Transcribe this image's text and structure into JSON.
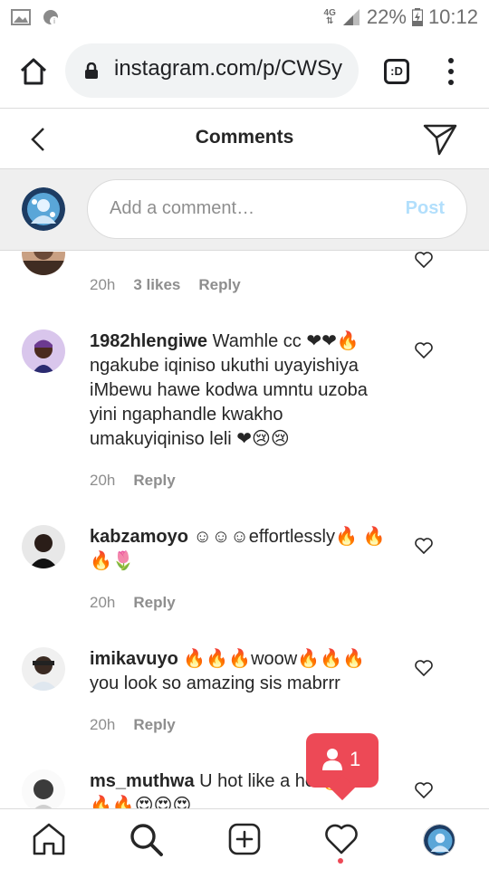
{
  "status_bar": {
    "network": "4G",
    "battery": "22%",
    "time": "10:12"
  },
  "browser": {
    "url": "instagram.com/p/CWSy",
    "tab_label": ":D"
  },
  "header": {
    "title": "Comments"
  },
  "composer": {
    "placeholder": "Add a comment…",
    "post_label": "Post"
  },
  "comments": [
    {
      "username": "",
      "text": "",
      "time": "20h",
      "likes": "3 likes",
      "reply": "Reply"
    },
    {
      "username": "1982hlengiwe",
      "text": " Wamhle cc ❤❤🔥 ngakube iqiniso ukuthi uyayishiya iMbewu hawe kodwa umntu uzoba yini ngaphandle kwakho umakuyiqiniso leli ❤😢😢",
      "time": "20h",
      "reply": "Reply"
    },
    {
      "username": "kabzamoyo",
      "text": " ☺☺☺effortlessly🔥 🔥🔥🌷",
      "time": "20h",
      "reply": "Reply"
    },
    {
      "username": "imikavuyo",
      "text": " 🔥🔥🔥woow🔥🔥🔥 you look so amazing sis mabrrr",
      "time": "20h",
      "reply": "Reply"
    },
    {
      "username": "ms_muthwa",
      "text": " U hot like a he 🔥🔥🔥😍😍😍",
      "time": "",
      "reply": ""
    }
  ],
  "notification": {
    "count": "1"
  },
  "colors": {
    "accent": "#0095f6",
    "post_disabled": "#b2dffc",
    "notification": "#ed4956",
    "text": "#262626",
    "muted": "#8e8e8e"
  },
  "icons": {
    "bottom_nav": [
      "home-icon",
      "search-icon",
      "new-post-icon",
      "activity-heart-icon",
      "profile-avatar"
    ]
  }
}
